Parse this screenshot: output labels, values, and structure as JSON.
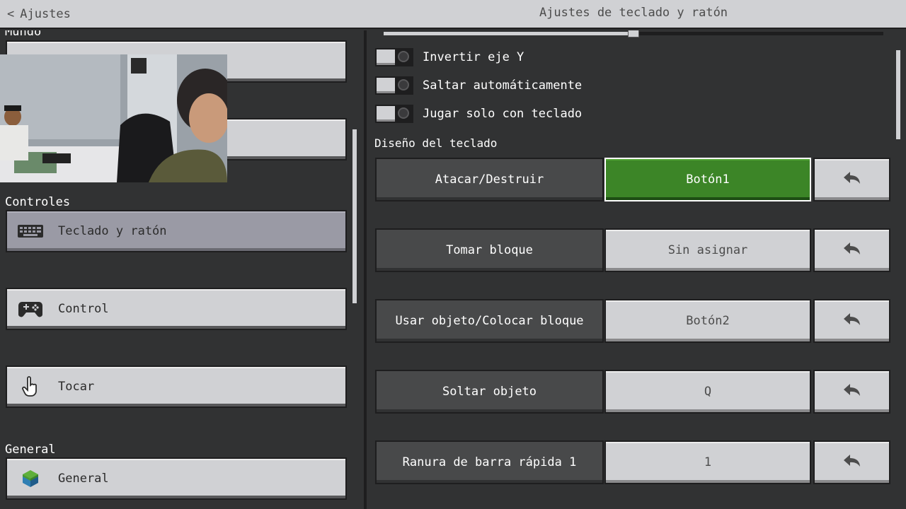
{
  "header": {
    "back_label": "Ajustes",
    "title": "Ajustes de teclado y ratón"
  },
  "sidebar": {
    "partial_section_label": "Mundo",
    "sections": [
      {
        "label": "Controles",
        "items": [
          {
            "label": "Teclado y ratón",
            "icon": "keyboard-icon",
            "selected": true
          },
          {
            "label": "Control",
            "icon": "gamepad-icon",
            "selected": false
          },
          {
            "label": "Tocar",
            "icon": "touch-hand-icon",
            "selected": false
          }
        ]
      },
      {
        "label": "General",
        "items": [
          {
            "label": "General",
            "icon": "grass-cube-icon",
            "selected": false
          }
        ]
      }
    ]
  },
  "settings": {
    "toggles": [
      {
        "label": "Invertir eje Y",
        "on": false
      },
      {
        "label": "Saltar automáticamente",
        "on": false
      },
      {
        "label": "Jugar solo con teclado",
        "on": false
      }
    ],
    "slider_fraction": 0.5,
    "layout_heading": "Diseño del teclado",
    "bindings": [
      {
        "action": "Atacar/Destruir",
        "key": "Botón1",
        "active": true
      },
      {
        "action": "Tomar bloque",
        "key": "Sin asignar",
        "active": false
      },
      {
        "action": "Usar objeto/Colocar bloque",
        "key": "Botón2",
        "active": false
      },
      {
        "action": "Soltar objeto",
        "key": "Q",
        "active": false
      },
      {
        "action": "Ranura de barra rápida 1",
        "key": "1",
        "active": false
      }
    ]
  },
  "colors": {
    "active_green": "#3c8527",
    "button_light": "#d0d1d4",
    "panel_dark": "#313233",
    "selected_nav": "#9a9aa5"
  }
}
